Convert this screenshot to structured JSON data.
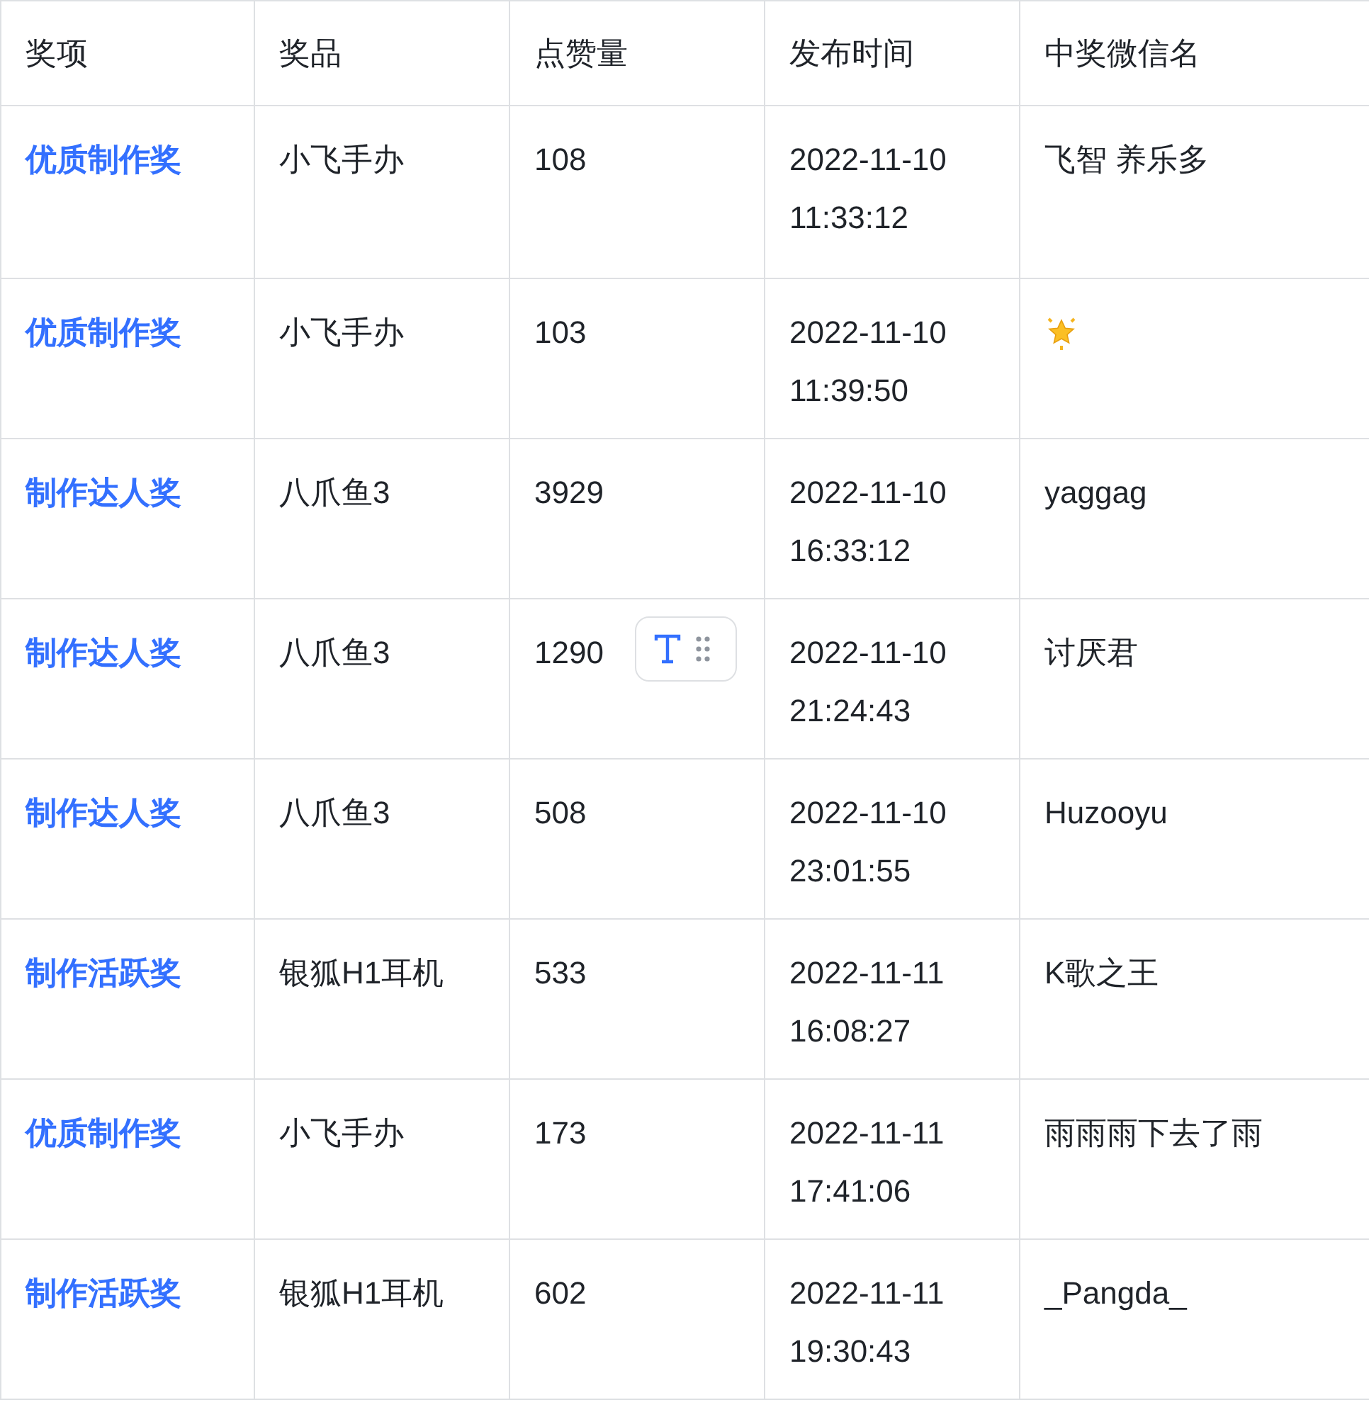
{
  "table": {
    "columns": [
      "奖项",
      "奖品",
      "点赞量",
      "发布时间",
      "中奖微信名"
    ],
    "rows": [
      {
        "award": "优质制作奖",
        "prize": "小飞手办",
        "likes": "108",
        "date": "2022-11-10",
        "time": "11:33:12",
        "winner": {
          "kind": "text",
          "text": "飞智 养乐多"
        },
        "toolbar_shown": false
      },
      {
        "award": "优质制作奖",
        "prize": "小飞手办",
        "likes": "103",
        "date": "2022-11-10",
        "time": "11:39:50",
        "winner": {
          "kind": "star"
        },
        "toolbar_shown": false
      },
      {
        "award": "制作达人奖",
        "prize": "八爪鱼3",
        "likes": "3929",
        "date": "2022-11-10",
        "time": "16:33:12",
        "winner": {
          "kind": "text",
          "text": "yaggag"
        },
        "toolbar_shown": false
      },
      {
        "award": "制作达人奖",
        "prize": "八爪鱼3",
        "likes": "1290",
        "date": "2022-11-10",
        "time": "21:24:43",
        "winner": {
          "kind": "text",
          "text": "讨厌君"
        },
        "toolbar_shown": true
      },
      {
        "award": "制作达人奖",
        "prize": "八爪鱼3",
        "likes": "508",
        "date": "2022-11-10",
        "time": "23:01:55",
        "winner": {
          "kind": "text",
          "text": "Huzooyu"
        },
        "toolbar_shown": false
      },
      {
        "award": "制作活跃奖",
        "prize": "银狐H1耳机",
        "likes": "533",
        "date": "2022-11-11",
        "time": "16:08:27",
        "winner": {
          "kind": "text",
          "text": "K歌之王"
        },
        "toolbar_shown": false
      },
      {
        "award": "优质制作奖",
        "prize": "小飞手办",
        "likes": "173",
        "date": "2022-11-11",
        "time": "17:41:06",
        "winner": {
          "kind": "text",
          "text": "雨雨雨下去了雨"
        },
        "toolbar_shown": false
      },
      {
        "award": "制作活跃奖",
        "prize": "银狐H1耳机",
        "likes": "602",
        "date": "2022-11-11",
        "time": "19:30:43",
        "winner": {
          "kind": "text",
          "text": "_Pangda_"
        },
        "toolbar_shown": false
      }
    ]
  }
}
